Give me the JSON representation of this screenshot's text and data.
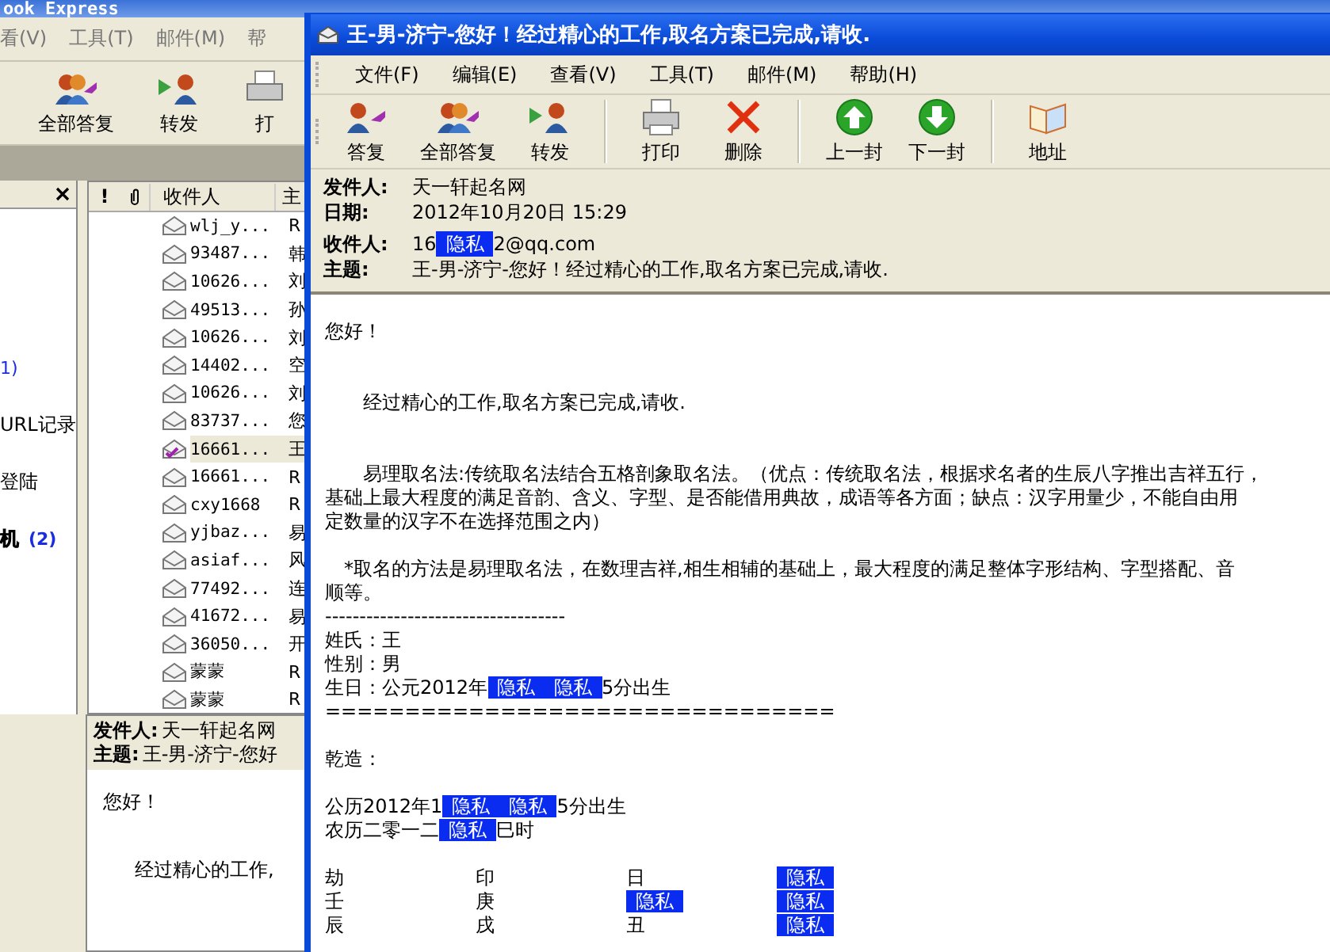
{
  "background_window": {
    "title": "ook Express",
    "menu": [
      "看(V)",
      "工具(T)",
      "邮件(M)",
      "帮"
    ],
    "toolbar": [
      {
        "label": "全部答复",
        "kind": "reply_all"
      },
      {
        "label": "转发",
        "kind": "forward"
      },
      {
        "label": "打",
        "kind": "print"
      }
    ],
    "folders": [
      {
        "count": "1)",
        "unread": false
      },
      {
        "name": "URL记录",
        "unread": false
      },
      {
        "name": "登陆",
        "unread": false
      },
      {
        "name": "机",
        "count": "(2)",
        "unread": true
      }
    ],
    "message_list": {
      "columns": [
        "!",
        "收件人",
        "主"
      ],
      "rows": [
        {
          "to": "wlj_y...",
          "subject": "R",
          "selected": false,
          "replied": false
        },
        {
          "to": "93487...",
          "subject": "韩",
          "selected": false,
          "replied": false
        },
        {
          "to": "10626...",
          "subject": "刘",
          "selected": false,
          "replied": false
        },
        {
          "to": "49513...",
          "subject": "孙",
          "selected": false,
          "replied": false
        },
        {
          "to": "10626...",
          "subject": "刘",
          "selected": false,
          "replied": false
        },
        {
          "to": "14402...",
          "subject": "空",
          "selected": false,
          "replied": false
        },
        {
          "to": "10626...",
          "subject": "刘",
          "selected": false,
          "replied": false
        },
        {
          "to": "83737...",
          "subject": "您",
          "selected": false,
          "replied": false
        },
        {
          "to": "16661...",
          "subject": "王",
          "selected": true,
          "replied": true
        },
        {
          "to": "16661...",
          "subject": "R",
          "selected": false,
          "replied": false
        },
        {
          "to": "cxy1668",
          "subject": "R",
          "selected": false,
          "replied": false
        },
        {
          "to": "yjbaz...",
          "subject": "易",
          "selected": false,
          "replied": false
        },
        {
          "to": "asiaf...",
          "subject": "风",
          "selected": false,
          "replied": false
        },
        {
          "to": "77492...",
          "subject": "连",
          "selected": false,
          "replied": false
        },
        {
          "to": "41672...",
          "subject": "易",
          "selected": false,
          "replied": false
        },
        {
          "to": "36050...",
          "subject": "开",
          "selected": false,
          "replied": false
        },
        {
          "to": "蒙蒙",
          "subject": "R",
          "selected": false,
          "replied": false
        },
        {
          "to": "蒙蒙",
          "subject": "R",
          "selected": false,
          "replied": false
        }
      ]
    },
    "preview": {
      "from_label": "发件人:",
      "from": "天一轩起名网",
      "subject_label": "主题:",
      "subject": "王-男-济宁-您好",
      "body": [
        "您好！",
        "经过精心的工作,"
      ]
    }
  },
  "message_window": {
    "title": "王-男-济宁-您好！经过精心的工作,取名方案已完成,请收.",
    "menu": [
      "文件(F)",
      "编辑(E)",
      "查看(V)",
      "工具(T)",
      "邮件(M)",
      "帮助(H)"
    ],
    "toolbar_groups": [
      [
        {
          "label": "答复",
          "kind": "reply"
        },
        {
          "label": "全部答复",
          "kind": "reply_all"
        },
        {
          "label": "转发",
          "kind": "forward"
        }
      ],
      [
        {
          "label": "打印",
          "kind": "print"
        },
        {
          "label": "删除",
          "kind": "delete"
        }
      ],
      [
        {
          "label": "上一封",
          "kind": "previous"
        },
        {
          "label": "下一封",
          "kind": "next"
        }
      ],
      [
        {
          "label": "地址",
          "kind": "addresses"
        }
      ]
    ],
    "header": [
      {
        "label": "发件人:",
        "segments": [
          {
            "text": "天一轩起名网",
            "redacted": false
          }
        ]
      },
      {
        "label": "日期:",
        "segments": [
          {
            "text": "2012年10月20日 15:29",
            "redacted": false
          }
        ]
      },
      {
        "label": "收件人:",
        "segments": [
          {
            "text": "16",
            "redacted": false
          },
          {
            "text": "隐私",
            "redacted": true
          },
          {
            "text": "2@qq.com",
            "redacted": false
          }
        ]
      },
      {
        "label": "主题:",
        "segments": [
          {
            "text": "王-男-济宁-您好！经过精心的工作,取名方案已完成,请收.",
            "redacted": false
          }
        ]
      }
    ],
    "body": [
      {
        "kind": "text",
        "segments": [
          {
            "text": "您好！",
            "redacted": false
          }
        ]
      },
      {
        "kind": "blank"
      },
      {
        "kind": "blank"
      },
      {
        "kind": "text",
        "segments": [
          {
            "text": "　　经过精心的工作,取名方案已完成,请收.",
            "redacted": false
          }
        ]
      },
      {
        "kind": "blank"
      },
      {
        "kind": "blank"
      },
      {
        "kind": "text",
        "segments": [
          {
            "text": "　　易理取名法:传统取名法结合五格剖象取名法。（优点：传统取名法，根据求名者的生辰八字推出吉祥五行，",
            "redacted": false
          }
        ]
      },
      {
        "kind": "text",
        "segments": [
          {
            "text": "基础上最大程度的满足音韵、含义、字型、是否能借用典故，成语等各方面；缺点：汉字用量少，不能自由用",
            "redacted": false
          }
        ]
      },
      {
        "kind": "text",
        "segments": [
          {
            "text": "定数量的汉字不在选择范围之内）",
            "redacted": false
          }
        ]
      },
      {
        "kind": "blank"
      },
      {
        "kind": "text",
        "segments": [
          {
            "text": "　*取名的方法是易理取名法，在数理吉祥,相生相辅的基础上，最大程度的满足整体字形结构、字型搭配、音",
            "redacted": false
          }
        ]
      },
      {
        "kind": "text",
        "segments": [
          {
            "text": "顺等。",
            "redacted": false
          }
        ]
      },
      {
        "kind": "text",
        "segments": [
          {
            "text": "-----------------------------------",
            "redacted": false
          }
        ]
      },
      {
        "kind": "text",
        "segments": [
          {
            "text": "姓氏：王",
            "redacted": false
          }
        ]
      },
      {
        "kind": "text",
        "segments": [
          {
            "text": "性别：男",
            "redacted": false
          }
        ]
      },
      {
        "kind": "text",
        "segments": [
          {
            "text": "生日：公元2012年",
            "redacted": false
          },
          {
            "text": "隐私　隐私",
            "redacted": true
          },
          {
            "text": "5分出生",
            "redacted": false
          }
        ]
      },
      {
        "kind": "text",
        "segments": [
          {
            "text": "================================",
            "redacted": false
          }
        ]
      },
      {
        "kind": "blank"
      },
      {
        "kind": "text",
        "segments": [
          {
            "text": "乾造：",
            "redacted": false
          }
        ]
      },
      {
        "kind": "blank"
      },
      {
        "kind": "text",
        "segments": [
          {
            "text": "公历2012年1",
            "redacted": false
          },
          {
            "text": "隐私",
            "redacted": true
          },
          {
            "text": "隐私",
            "redacted": true
          },
          {
            "text": "5分出生",
            "redacted": false
          }
        ]
      },
      {
        "kind": "text",
        "segments": [
          {
            "text": "农历二零一二",
            "redacted": false
          },
          {
            "text": "隐私",
            "redacted": true
          },
          {
            "text": "巳时",
            "redacted": false
          }
        ]
      },
      {
        "kind": "blank"
      },
      {
        "kind": "row",
        "cells": [
          {
            "text": "劫",
            "redacted": false
          },
          {
            "text": "印",
            "redacted": false
          },
          {
            "text": "日",
            "redacted": false
          },
          {
            "text": "隐私",
            "redacted": true
          }
        ]
      },
      {
        "kind": "row",
        "cells": [
          {
            "text": "壬",
            "redacted": false
          },
          {
            "text": "庚",
            "redacted": false
          },
          {
            "text": "隐私",
            "redacted": true
          },
          {
            "text": "隐私",
            "redacted": true
          }
        ]
      },
      {
        "kind": "row",
        "cells": [
          {
            "text": "辰",
            "redacted": false
          },
          {
            "text": "戌",
            "redacted": false
          },
          {
            "text": "丑",
            "redacted": false
          },
          {
            "text": "隐私",
            "redacted": true
          }
        ]
      }
    ]
  }
}
